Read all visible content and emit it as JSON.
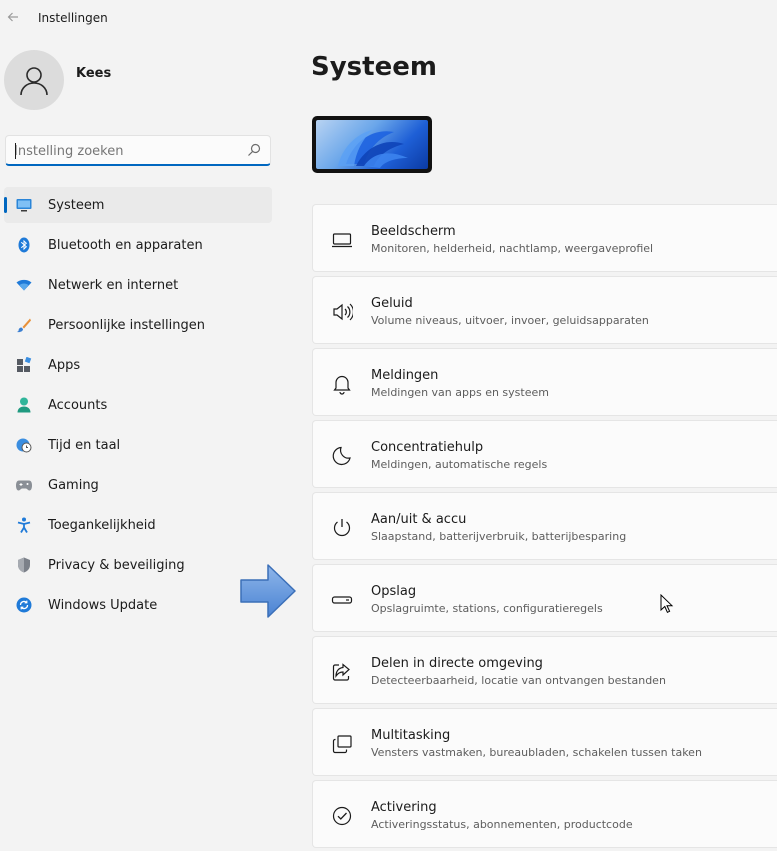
{
  "window": {
    "title": "Instellingen"
  },
  "profile": {
    "name": "Kees"
  },
  "search": {
    "placeholder": "Instelling zoeken"
  },
  "sidebar": {
    "items": [
      {
        "label": "Systeem",
        "icon": "monitor-icon",
        "active": true
      },
      {
        "label": "Bluetooth en apparaten",
        "icon": "bluetooth-icon"
      },
      {
        "label": "Netwerk en internet",
        "icon": "wifi-icon"
      },
      {
        "label": "Persoonlijke instellingen",
        "icon": "brush-icon"
      },
      {
        "label": "Apps",
        "icon": "apps-icon"
      },
      {
        "label": "Accounts",
        "icon": "person-icon"
      },
      {
        "label": "Tijd en taal",
        "icon": "globe-clock-icon"
      },
      {
        "label": "Gaming",
        "icon": "gamepad-icon"
      },
      {
        "label": "Toegankelijkheid",
        "icon": "accessibility-icon"
      },
      {
        "label": "Privacy & beveiliging",
        "icon": "shield-icon"
      },
      {
        "label": "Windows Update",
        "icon": "update-icon"
      }
    ]
  },
  "main": {
    "title": "Systeem",
    "cards": [
      {
        "title": "Beeldscherm",
        "subtitle": "Monitoren, helderheid, nachtlamp, weergaveprofiel",
        "icon": "display-icon"
      },
      {
        "title": "Geluid",
        "subtitle": "Volume niveaus, uitvoer, invoer, geluidsapparaten",
        "icon": "speaker-icon"
      },
      {
        "title": "Meldingen",
        "subtitle": "Meldingen van apps en systeem",
        "icon": "bell-icon"
      },
      {
        "title": "Concentratiehulp",
        "subtitle": "Meldingen, automatische regels",
        "icon": "moon-icon"
      },
      {
        "title": "Aan/uit & accu",
        "subtitle": "Slaapstand, batterijverbruik, batterijbesparing",
        "icon": "power-icon"
      },
      {
        "title": "Opslag",
        "subtitle": "Opslagruimte, stations, configuratieregels",
        "icon": "storage-icon"
      },
      {
        "title": "Delen in directe omgeving",
        "subtitle": "Detecteerbaarheid, locatie van ontvangen bestanden",
        "icon": "share-icon"
      },
      {
        "title": "Multitasking",
        "subtitle": "Vensters vastmaken, bureaubladen, schakelen tussen taken",
        "icon": "multitask-icon"
      },
      {
        "title": "Activering",
        "subtitle": "Activeringsstatus, abonnementen, productcode",
        "icon": "check-circle-icon"
      }
    ]
  },
  "colors": {
    "accent": "#0067c0",
    "background": "#f3f3f3",
    "card": "#fbfbfb"
  }
}
